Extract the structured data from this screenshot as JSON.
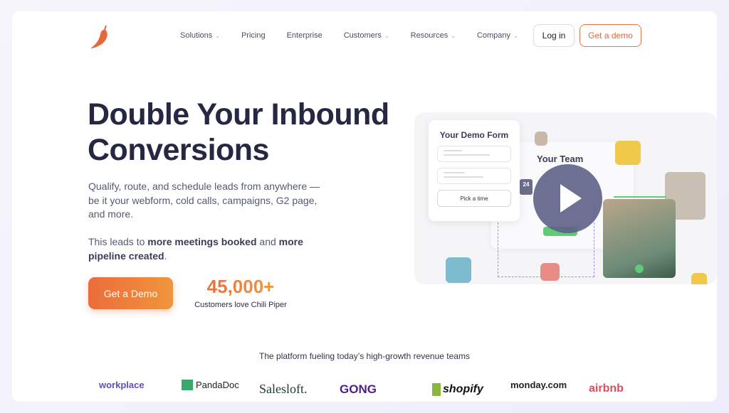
{
  "nav": {
    "items": [
      {
        "label": "Solutions",
        "dropdown": true
      },
      {
        "label": "Pricing",
        "dropdown": false
      },
      {
        "label": "Enterprise",
        "dropdown": false
      },
      {
        "label": "Customers",
        "dropdown": true
      },
      {
        "label": "Resources",
        "dropdown": true
      },
      {
        "label": "Company",
        "dropdown": true
      }
    ],
    "login": "Log in",
    "demo": "Get a demo"
  },
  "hero": {
    "title": "Double Your Inbound Conversions",
    "description": "Qualify, route, and schedule leads from anywhere — be it your webform, cold calls, campaigns, G2 page, and more.",
    "lead_pre": "This leads to ",
    "lead_b1": "more meetings booked",
    "lead_mid": " and ",
    "lead_b2": "more pipeline created",
    "lead_end": ".",
    "cta": "Get a Demo",
    "stat_number": "45,000+",
    "stat_label": "Customers love Chili Piper"
  },
  "video": {
    "form_title": "Your Demo Form",
    "pick_time": "Pick a time",
    "team_title": "Your Team",
    "date": "24"
  },
  "tagline": "The platform fueling today’s high-growth revenue teams",
  "logos": [
    "workplace",
    "PandaDoc",
    "Salesloft.",
    "GONG",
    "shopify",
    "monday.com",
    "airbnb"
  ],
  "colors": {
    "brand": "#e9673b",
    "heading": "#262843"
  }
}
